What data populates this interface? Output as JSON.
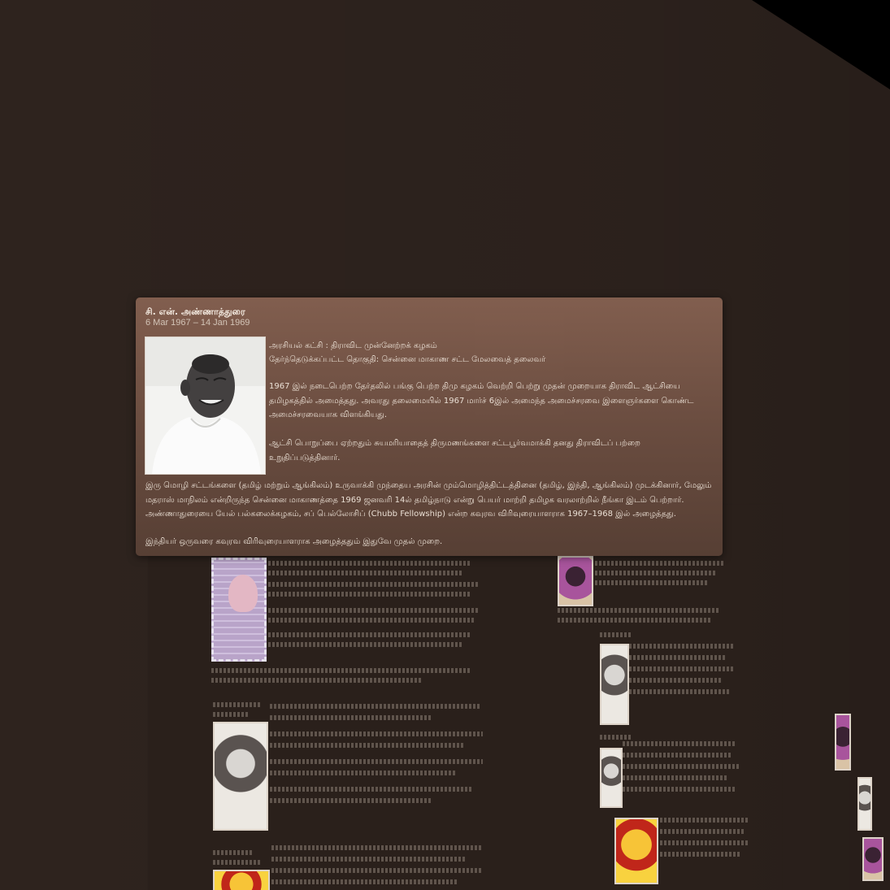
{
  "popup": {
    "name": "சி. என். அண்ணாத்துரை",
    "dates": "6 Mar 1967 – 14 Jan 1969",
    "party_line": "அரசியல் கட்சி : திராவிட முன்னேற்றக் கழகம்",
    "constituency_line": "தேர்ந்தெடுக்கப்பட்ட தொகுதி: சென்னை மாகாண சட்ட மேலவைத் தலைவர்",
    "para1": [
      "1967 இல் நடைபெற்ற தேர்தலில் பங்கு பெற்ற திமு கழகம் வெற்றி பெற்று முதன் முறையாக திராவிட ஆட்சியை",
      "தமிழகத்தில் அமைத்தது. அவரது தலைமையில் 1967 மார்ச் 6இல் அமைந்த அமைச்சரவை இளைஞர்களை கொண்ட",
      "அமைச்சரவையாக விளங்கியது."
    ],
    "para2": [
      "ஆட்சி பொறுப்பை ஏற்றதும் சுயமரியாதைத் திருமணங்களை சட்டபூர்வமாக்கி தனது திராவிடப் பற்றை",
      "உறுதிப்படுத்தினார்."
    ],
    "para3": [
      "இரு மொழி சட்டங்களை (தமிழ் மற்றும் ஆங்கிலம்) உருவாக்கி முந்தைய அரசின் மும்மொழித்திட்டத்தினை (தமிழ், இந்தி, ஆங்கிலம்) முடக்கினார், மேலும்",
      "மதராஸ் மாநிலம் என்றிருந்த சென்னை மாகாணத்தை 1969 ஜனவரி 14ல் தமிழ்நாடு என்று பெயர் மாற்றி தமிழக வரலாற்றில் நீங்கா இடம் பெற்றார்.",
      "அண்ணாதுரையை யேல் பல்கலைக்கழகம், சப் பெல்லோசிப் (Chubb Fellowship) என்ற கவுரவ விரிவுரையாளராக 1967–1968 இல் அழைத்தது."
    ],
    "para4": "இந்தியர் ஒருவரை கவுரவ விரிவுரையாளராக அழைத்ததும் இதுவே முதல் முறை."
  }
}
